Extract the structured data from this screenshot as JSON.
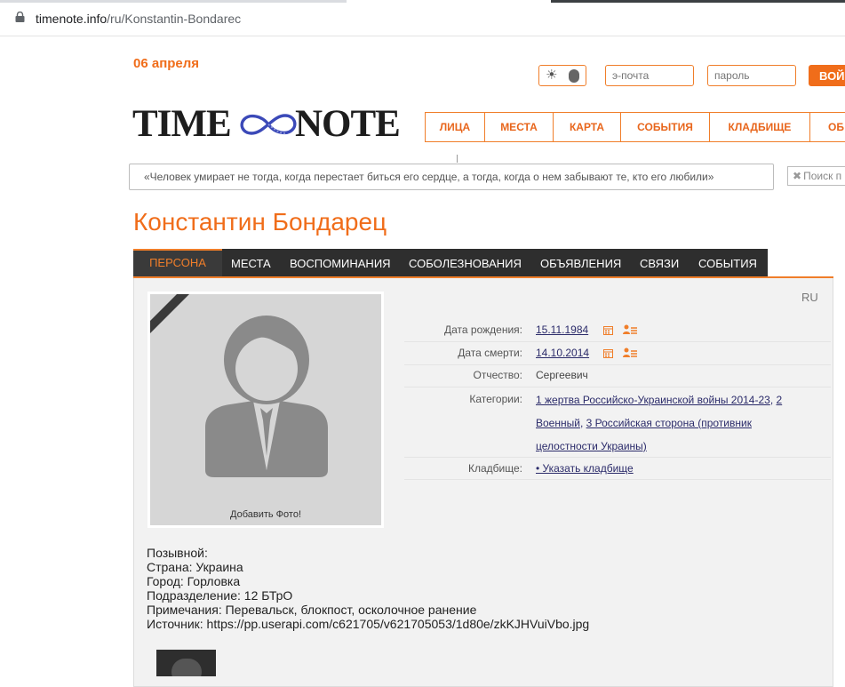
{
  "browser": {
    "url_host": "timenote.info",
    "url_path": "/ru/Konstantin-Bondarec"
  },
  "header": {
    "date": "06 апреля",
    "email_placeholder": "э-почта",
    "password_placeholder": "пароль",
    "login_label": "ВОЙ",
    "logo_left": "TIME",
    "logo_right": "NOTE",
    "nav": [
      "ЛИЦА",
      "МЕСТА",
      "КАРТА",
      "СОБЫТИЯ",
      "КЛАДБИЩЕ",
      "ОБ"
    ],
    "quote": "«Человек умирает не тогда, когда перестает биться его сердце, а тогда, когда о нем забывают те, кто его любили»",
    "search_placeholder": "Поиск п"
  },
  "person": {
    "name": "Константин Бондарец",
    "tabs": [
      "ПЕРСОНА",
      "МЕСТА",
      "ВОСПОМИНАНИЯ",
      "СОБОЛЕЗНОВАНИЯ",
      "ОБЪЯВЛЕНИЯ",
      "СВЯЗИ",
      "СОБЫТИЯ"
    ],
    "lang": "RU",
    "add_photo": "Добавить Фото!",
    "fields": {
      "birth_label": "Дата рождения:",
      "birth_value": "15.11.1984",
      "death_label": "Дата смерти:",
      "death_value": "14.10.2014",
      "patronymic_label": "Отчество:",
      "patronymic_value": "Сергеевич",
      "categories_label": "Категории:",
      "categories": [
        "1 жертва Российско-Украинской войны 2014-23",
        "2 Военный",
        "3 Российская сторона (противник целостности Украины)"
      ],
      "cemetery_label": "Кладбище:",
      "cemetery_value": "• Указать кладбище"
    },
    "details": [
      "Позывной:",
      "Страна: Украина",
      "Город: Горловка",
      "Подразделение: 12 БТрО",
      "Примечания: Перевальск, блокпост, осколочное ранение",
      "Источник: https://pp.userapi.com/c621705/v621705053/1d80e/zkKJHVuiVbo.jpg"
    ]
  },
  "colors": {
    "accent": "#f06d1a",
    "dark_bar": "#2e2e2e",
    "panel_bg": "#f2f2f2",
    "link": "#2b2b6a"
  }
}
